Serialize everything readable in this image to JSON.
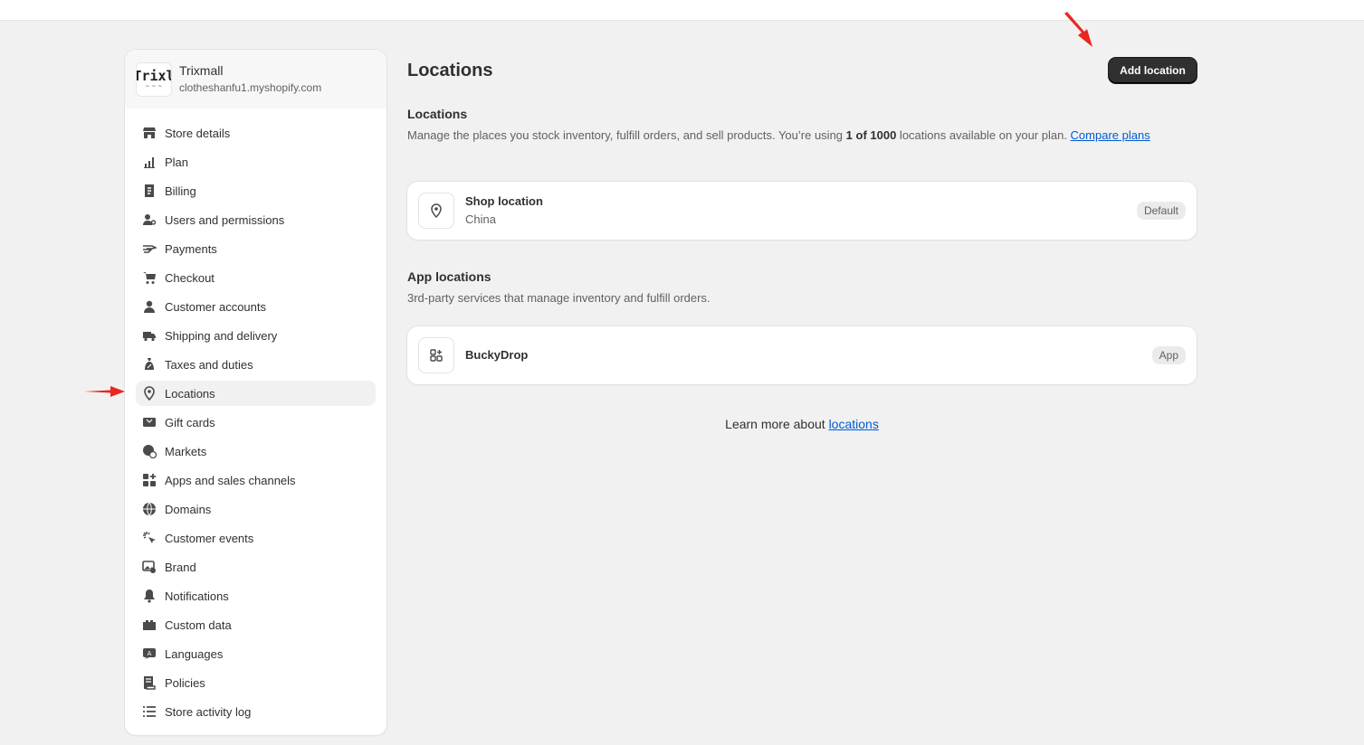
{
  "store": {
    "logo_text": "Trixl",
    "name": "Trixmall",
    "domain": "clotheshanfu1.myshopify.com"
  },
  "sidebar": {
    "items": [
      {
        "label": "Store details",
        "icon": "store-icon"
      },
      {
        "label": "Plan",
        "icon": "chart-icon"
      },
      {
        "label": "Billing",
        "icon": "receipt-icon"
      },
      {
        "label": "Users and permissions",
        "icon": "users-icon"
      },
      {
        "label": "Payments",
        "icon": "hand-money-icon"
      },
      {
        "label": "Checkout",
        "icon": "cart-icon"
      },
      {
        "label": "Customer accounts",
        "icon": "person-icon"
      },
      {
        "label": "Shipping and delivery",
        "icon": "truck-icon"
      },
      {
        "label": "Taxes and duties",
        "icon": "tax-bag-icon"
      },
      {
        "label": "Locations",
        "icon": "location-pin-icon"
      },
      {
        "label": "Gift cards",
        "icon": "gift-card-icon"
      },
      {
        "label": "Markets",
        "icon": "globe-dollar-icon"
      },
      {
        "label": "Apps and sales channels",
        "icon": "apps-icon"
      },
      {
        "label": "Domains",
        "icon": "globe-icon"
      },
      {
        "label": "Customer events",
        "icon": "cursor-click-icon"
      },
      {
        "label": "Brand",
        "icon": "image-icon"
      },
      {
        "label": "Notifications",
        "icon": "bell-icon"
      },
      {
        "label": "Custom data",
        "icon": "custom-data-icon"
      },
      {
        "label": "Languages",
        "icon": "language-icon"
      },
      {
        "label": "Policies",
        "icon": "policy-icon"
      },
      {
        "label": "Store activity log",
        "icon": "list-icon"
      }
    ],
    "active": "Locations"
  },
  "main": {
    "title": "Locations",
    "add_button": "Add location",
    "locations_section": {
      "heading": "Locations",
      "desc_pre": "Manage the places you stock inventory, fulfill orders, and sell products. You’re using ",
      "desc_bold": "1 of 1000",
      "desc_post": " locations available on your plan. ",
      "desc_link": "Compare plans"
    },
    "shop_location": {
      "title": "Shop location",
      "subtitle": "China",
      "badge": "Default"
    },
    "app_section": {
      "heading": "App locations",
      "desc": "3rd-party services that manage inventory and fulfill orders."
    },
    "app_location": {
      "title": "BuckyDrop",
      "badge": "App"
    },
    "learn_more": {
      "text": "Learn more about ",
      "link": "locations"
    }
  },
  "colors": {
    "background": "#f1f1f1",
    "primary_button": "#303030",
    "link": "#005bd3",
    "annotation_arrow": "#e8281e"
  }
}
